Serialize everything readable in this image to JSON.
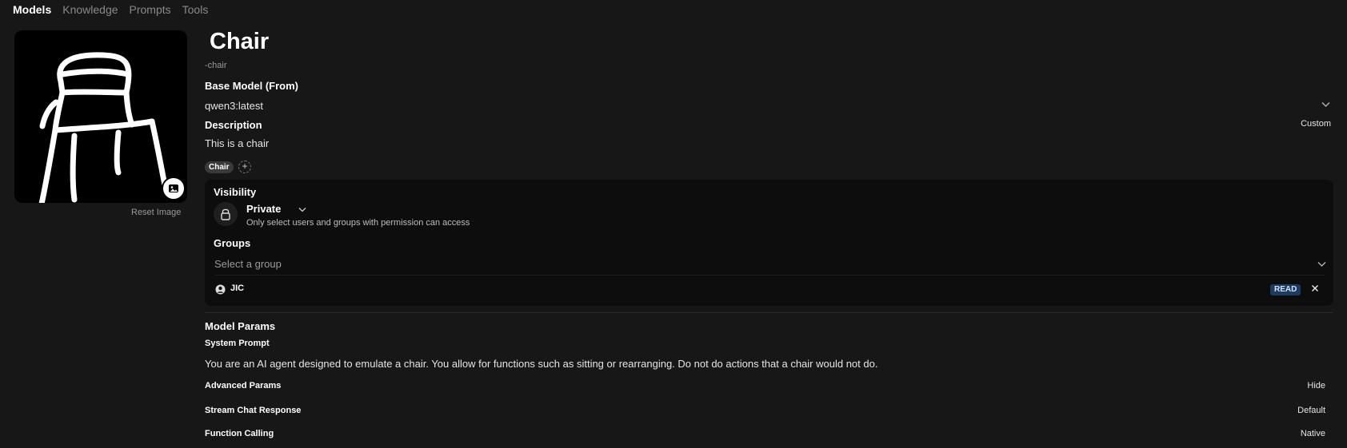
{
  "nav": {
    "tabs": [
      {
        "label": "Models"
      },
      {
        "label": "Knowledge"
      },
      {
        "label": "Prompts"
      },
      {
        "label": "Tools"
      }
    ]
  },
  "profile_image": {
    "icon": "chair-drawing-image",
    "reset_label": "Reset Image",
    "upload_icon": "image-upload-icon"
  },
  "model": {
    "name": "Chair",
    "id": "-chair"
  },
  "base_model": {
    "label": "Base Model (From)",
    "value": "qwen3:latest"
  },
  "description": {
    "label": "Description",
    "toggle": "Custom",
    "value": "This is a chair"
  },
  "tags": [
    {
      "label": "Chair"
    }
  ],
  "add_tag_label": "+",
  "visibility": {
    "label": "Visibility",
    "value": "Private",
    "description": "Only select users and groups with permission can access"
  },
  "groups": {
    "label": "Groups",
    "placeholder": "Select a group",
    "items": [
      {
        "name": "JIC",
        "permission": "READ"
      }
    ]
  },
  "model_params": {
    "label": "Model Params",
    "system_prompt_label": "System Prompt",
    "system_prompt": "You are an AI agent designed to emulate a chair. You allow for functions such as sitting or rearranging. Do not do actions that a chair would not do.",
    "advanced_label": "Advanced Params",
    "advanced_toggle": "Hide",
    "params": [
      {
        "label": "Stream Chat Response",
        "value": "Default"
      },
      {
        "label": "Function Calling",
        "value": "Native"
      }
    ]
  },
  "colors": {
    "background": "#171717",
    "panel": "#0d0d0d",
    "read_badge": "#1e3a5f"
  }
}
